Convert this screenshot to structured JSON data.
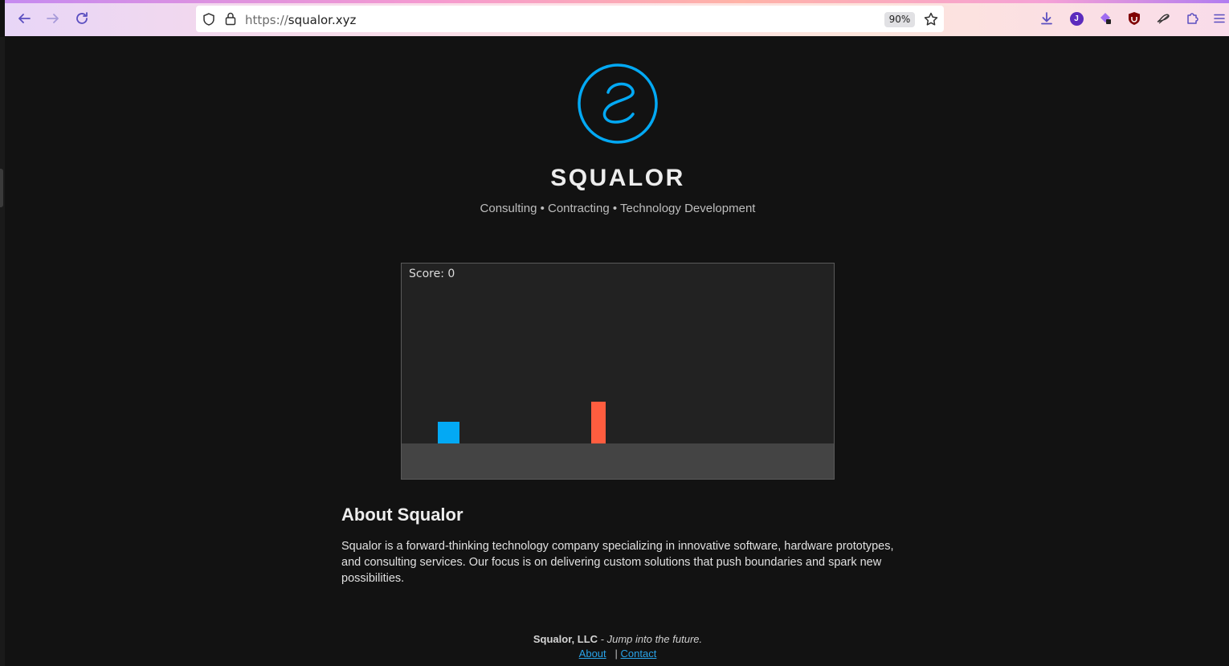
{
  "browser": {
    "url_scheme": "https://",
    "url_host": "squalor.xyz",
    "zoom": "90%",
    "account_initial": "J"
  },
  "colors": {
    "accent": "#03a9f4",
    "obstacle": "#ff5d3f",
    "background": "#121212",
    "link": "#29a3e8"
  },
  "header": {
    "title": "SQUALOR",
    "tagline": "Consulting • Contracting • Technology Development"
  },
  "game": {
    "score_label": "Score: 0"
  },
  "about": {
    "heading": "About Squalor",
    "body": "Squalor is a forward-thinking technology company specializing in innovative software, hardware prototypes, and consulting services. Our focus is on delivering custom solutions that push boundaries and spark new possibilities."
  },
  "footer": {
    "company": "Squalor, LLC",
    "slogan": " - Jump into the future.",
    "separator": "|",
    "link_about": "About",
    "link_contact": "Contact"
  },
  "icons": [
    "back-icon",
    "forward-icon",
    "reload-icon",
    "shield-icon",
    "lock-icon",
    "star-icon",
    "download-icon",
    "account-icon",
    "extension-icon",
    "ublock-icon",
    "extension-icon-2",
    "extensions-icon",
    "menu-icon"
  ]
}
